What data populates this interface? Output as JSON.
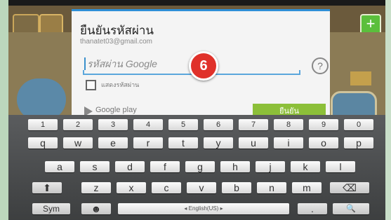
{
  "dialog": {
    "title": "ยืนยันรหัสผ่าน",
    "email": "thanatet03@gmail.com",
    "password_placeholder": "รหัสผ่าน Google",
    "step_badge": "6",
    "help_icon": "?",
    "checkbox_label": "แสดงรหัสผ่าน",
    "google_play_label": "Google play",
    "confirm_label": "ยืนยัน"
  },
  "keyboard": {
    "row1": [
      "1",
      "2",
      "3",
      "4",
      "5",
      "6",
      "7",
      "8",
      "9",
      "0"
    ],
    "row2": [
      "q",
      "w",
      "e",
      "r",
      "t",
      "y",
      "u",
      "i",
      "o",
      "p"
    ],
    "row3": [
      "a",
      "s",
      "d",
      "f",
      "g",
      "h",
      "j",
      "k",
      "l"
    ],
    "row4": [
      "z",
      "x",
      "c",
      "v",
      "b",
      "n",
      "m"
    ],
    "shift_icon": "⬆",
    "backspace_icon": "⌫",
    "sym_label": "Sym",
    "emoji_icon": "☻",
    "space_label": "◂ English(US) ▸",
    "period_label": ".",
    "search_icon": "🔍"
  },
  "game": {
    "plus_icon": "+"
  },
  "colors": {
    "accent_blue": "#2f8fd6",
    "confirm_green": "#8cbf39",
    "badge_red": "#e0312a"
  }
}
